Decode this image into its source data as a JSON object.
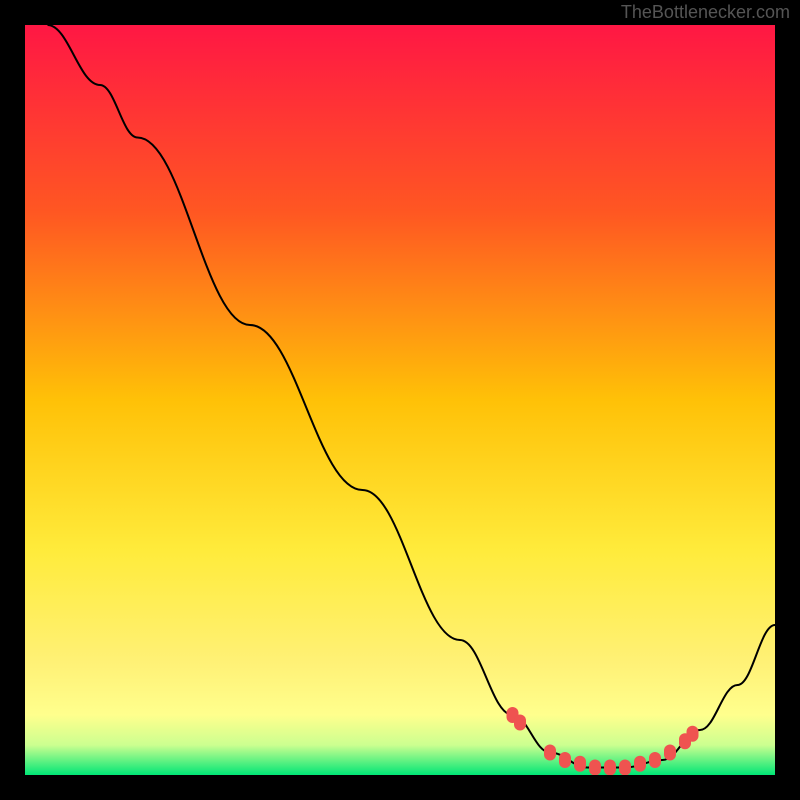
{
  "watermark": "TheBottlenecker.com",
  "chart_data": {
    "type": "line",
    "title": "",
    "xlabel": "",
    "ylabel": "",
    "xlim": [
      0,
      100
    ],
    "ylim": [
      0,
      100
    ],
    "gradient_colors": [
      {
        "offset": 0,
        "color": "#ff1744"
      },
      {
        "offset": 25,
        "color": "#ff5722"
      },
      {
        "offset": 50,
        "color": "#ffc107"
      },
      {
        "offset": 70,
        "color": "#ffeb3b"
      },
      {
        "offset": 85,
        "color": "#fff176"
      },
      {
        "offset": 92,
        "color": "#ffff8d"
      },
      {
        "offset": 96,
        "color": "#ccff90"
      },
      {
        "offset": 100,
        "color": "#00e676"
      }
    ],
    "curve_points": [
      {
        "x": 3,
        "y": 100
      },
      {
        "x": 10,
        "y": 92
      },
      {
        "x": 15,
        "y": 85
      },
      {
        "x": 30,
        "y": 60
      },
      {
        "x": 45,
        "y": 38
      },
      {
        "x": 58,
        "y": 18
      },
      {
        "x": 65,
        "y": 8
      },
      {
        "x": 70,
        "y": 3
      },
      {
        "x": 75,
        "y": 1
      },
      {
        "x": 80,
        "y": 1
      },
      {
        "x": 85,
        "y": 2
      },
      {
        "x": 90,
        "y": 6
      },
      {
        "x": 95,
        "y": 12
      },
      {
        "x": 100,
        "y": 20
      }
    ],
    "marker_points": [
      {
        "x": 65,
        "y": 8
      },
      {
        "x": 66,
        "y": 7
      },
      {
        "x": 70,
        "y": 3
      },
      {
        "x": 72,
        "y": 2
      },
      {
        "x": 74,
        "y": 1.5
      },
      {
        "x": 76,
        "y": 1
      },
      {
        "x": 78,
        "y": 1
      },
      {
        "x": 80,
        "y": 1
      },
      {
        "x": 82,
        "y": 1.5
      },
      {
        "x": 84,
        "y": 2
      },
      {
        "x": 86,
        "y": 3
      },
      {
        "x": 88,
        "y": 4.5
      },
      {
        "x": 89,
        "y": 5.5
      }
    ],
    "marker_color": "#ef5350",
    "curve_color": "#000000"
  }
}
